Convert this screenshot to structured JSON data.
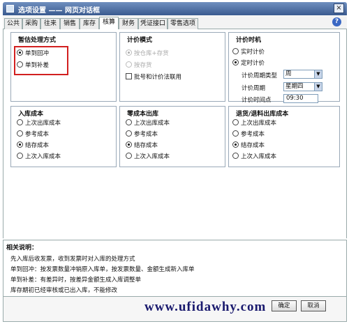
{
  "window": {
    "title": "选项设置 —— 网页对话框",
    "close_glyph": "×"
  },
  "tabs": [
    {
      "label": "公共",
      "active": false
    },
    {
      "label": "采购",
      "active": false
    },
    {
      "label": "往来",
      "active": false
    },
    {
      "label": "销售",
      "active": false
    },
    {
      "label": "库存",
      "active": false
    },
    {
      "label": "核算",
      "active": true
    },
    {
      "label": "财务",
      "active": false
    },
    {
      "label": "凭证接口",
      "active": false
    },
    {
      "label": "零售选项",
      "active": false
    }
  ],
  "help_glyph": "?",
  "groups": {
    "provisional": {
      "title": "暂估处理方式",
      "options": [
        {
          "label": "单到回冲",
          "selected": true
        },
        {
          "label": "单到补差",
          "selected": false
        }
      ]
    },
    "pricing_mode": {
      "title": "计价模式",
      "options": [
        {
          "label": "按仓库+存货",
          "selected": true,
          "disabled": true
        },
        {
          "label": "按存货",
          "selected": false,
          "disabled": true
        }
      ],
      "checkbox": {
        "label": "批号和计价法联用",
        "checked": false
      }
    },
    "pricing_time": {
      "title": "计价时机",
      "options": [
        {
          "label": "实时计价",
          "selected": false
        },
        {
          "label": "定时计价",
          "selected": true
        }
      ],
      "period_type": {
        "label": "计价周期类型",
        "value": "周"
      },
      "period": {
        "label": "计价周期",
        "value": "星期四"
      },
      "time": {
        "label": "计价时间点",
        "value": "09:30"
      }
    },
    "inbound_cost": {
      "title": "入库成本",
      "options": [
        {
          "label": "上次出库成本",
          "selected": false
        },
        {
          "label": "参考成本",
          "selected": false
        },
        {
          "label": "结存成本",
          "selected": true
        },
        {
          "label": "上次入库成本",
          "selected": false
        }
      ]
    },
    "zero_cost_outbound": {
      "title": "零成本出库",
      "options": [
        {
          "label": "上次出库成本",
          "selected": false
        },
        {
          "label": "参考成本",
          "selected": false
        },
        {
          "label": "结存成本",
          "selected": true
        },
        {
          "label": "上次入库成本",
          "selected": false
        }
      ]
    },
    "return_cost": {
      "title": "退货/退料出库成本",
      "options": [
        {
          "label": "上次出库成本",
          "selected": false
        },
        {
          "label": "参考成本",
          "selected": false
        },
        {
          "label": "结存成本",
          "selected": true
        },
        {
          "label": "上次入库成本",
          "selected": false
        }
      ]
    }
  },
  "description": {
    "title": "相关说明：",
    "lines": [
      "先入库后收发票，收到发票时对入库的处理方式",
      "单到回冲：按发票数量冲销原入库单，按发票数量、金额生成新入库单",
      "单到补差：有差异时，按差异金额生成入库调整单",
      "库存期初已经审核或已出入库，不能修改"
    ]
  },
  "watermark": "www.ufidawhy.com",
  "buttons": {
    "ok": "确定",
    "cancel": "取消"
  },
  "colors": {
    "highlight_border": "#d21f1f",
    "title_bar": "#3a5a8f"
  }
}
